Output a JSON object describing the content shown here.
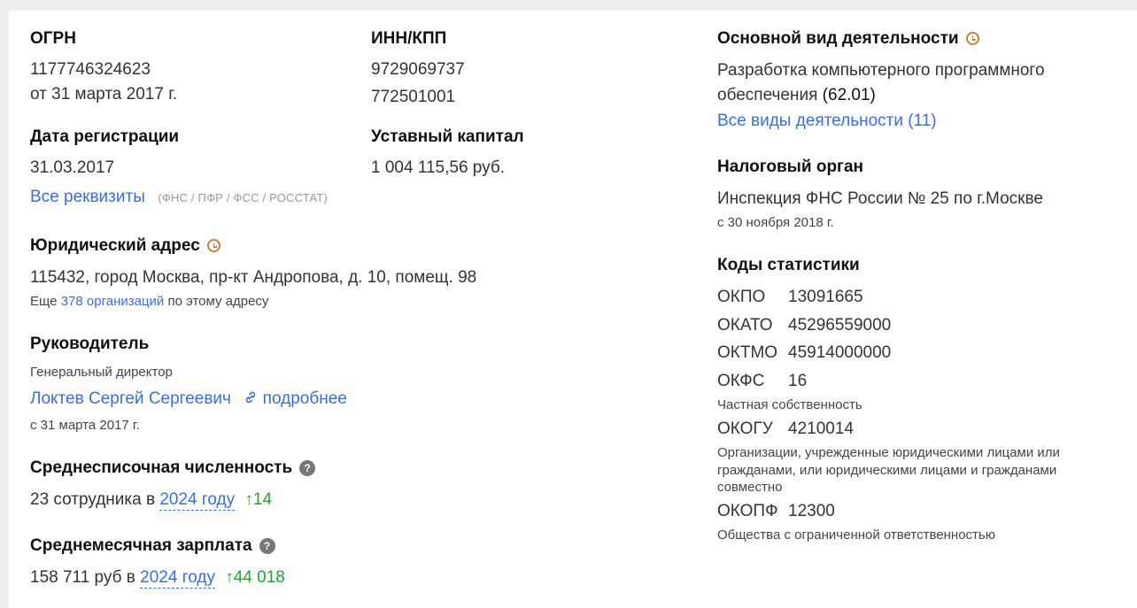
{
  "ogrn": {
    "label": "ОГРН",
    "number": "1177746324623",
    "date": "от 31 марта 2017 г."
  },
  "inn": {
    "label": "ИНН/КПП",
    "inn": "9729069737",
    "kpp": "772501001"
  },
  "activity": {
    "label": "Основной вид деятельности",
    "line1": "Разработка компьютерного программного",
    "line2": "обеспечения",
    "code": "(62.01)",
    "all_link": "Все виды деятельности (11)"
  },
  "registration": {
    "label": "Дата регистрации",
    "date": "31.03.2017"
  },
  "capital": {
    "label": "Уставный капитал",
    "value": "1 004 115,56 руб."
  },
  "requisites": {
    "link": "Все реквизиты",
    "note": "(ФНС / ПФР / ФСС / РОССТАТ)"
  },
  "tax": {
    "label": "Налоговый орган",
    "name": "Инспекция ФНС России № 25 по г.Москве",
    "since": "с 30 ноября 2018 г."
  },
  "address": {
    "label": "Юридический адрес",
    "value": "115432, город Москва, пр-кт Андропова, д. 10, помещ. 98",
    "more_prefix": "Еще",
    "more_link": "378 организаций",
    "more_suffix": "по этому адресу"
  },
  "stats": {
    "label": "Коды статистики",
    "okpo": {
      "code": "ОКПО",
      "value": "13091665"
    },
    "okato": {
      "code": "ОКАТО",
      "value": "45296559000"
    },
    "oktmo": {
      "code": "ОКТМО",
      "value": "45914000000"
    },
    "okfs": {
      "code": "ОКФС",
      "value": "16",
      "desc": "Частная собственность"
    },
    "okogu": {
      "code": "ОКОГУ",
      "value": "4210014",
      "desc1": "Организации, учрежденные юридическими лицами или",
      "desc2": "гражданами, или юридическими лицами и гражданами",
      "desc3": "совместно"
    },
    "okopf": {
      "code": "ОКОПФ",
      "value": "12300",
      "desc": "Общества с ограниченной ответственностью"
    }
  },
  "head": {
    "label": "Руководитель",
    "position": "Генеральный директор",
    "name": "Локтев Сергей Сергеевич",
    "more": "подробнее",
    "since": "с 31 марта 2017 г."
  },
  "employees": {
    "label": "Среднесписочная численность",
    "value_prefix": "23 сотрудника в",
    "year_link": "2024 году",
    "delta": "14",
    "help": "?"
  },
  "salary": {
    "label": "Среднемесячная зарплата",
    "value_prefix": "158 711 руб в",
    "year_link": "2024 году",
    "delta": "44 018",
    "help": "?"
  },
  "colors": {
    "link": "#3a6fd8",
    "positive": "#22a330",
    "accent": "#c8803a"
  }
}
